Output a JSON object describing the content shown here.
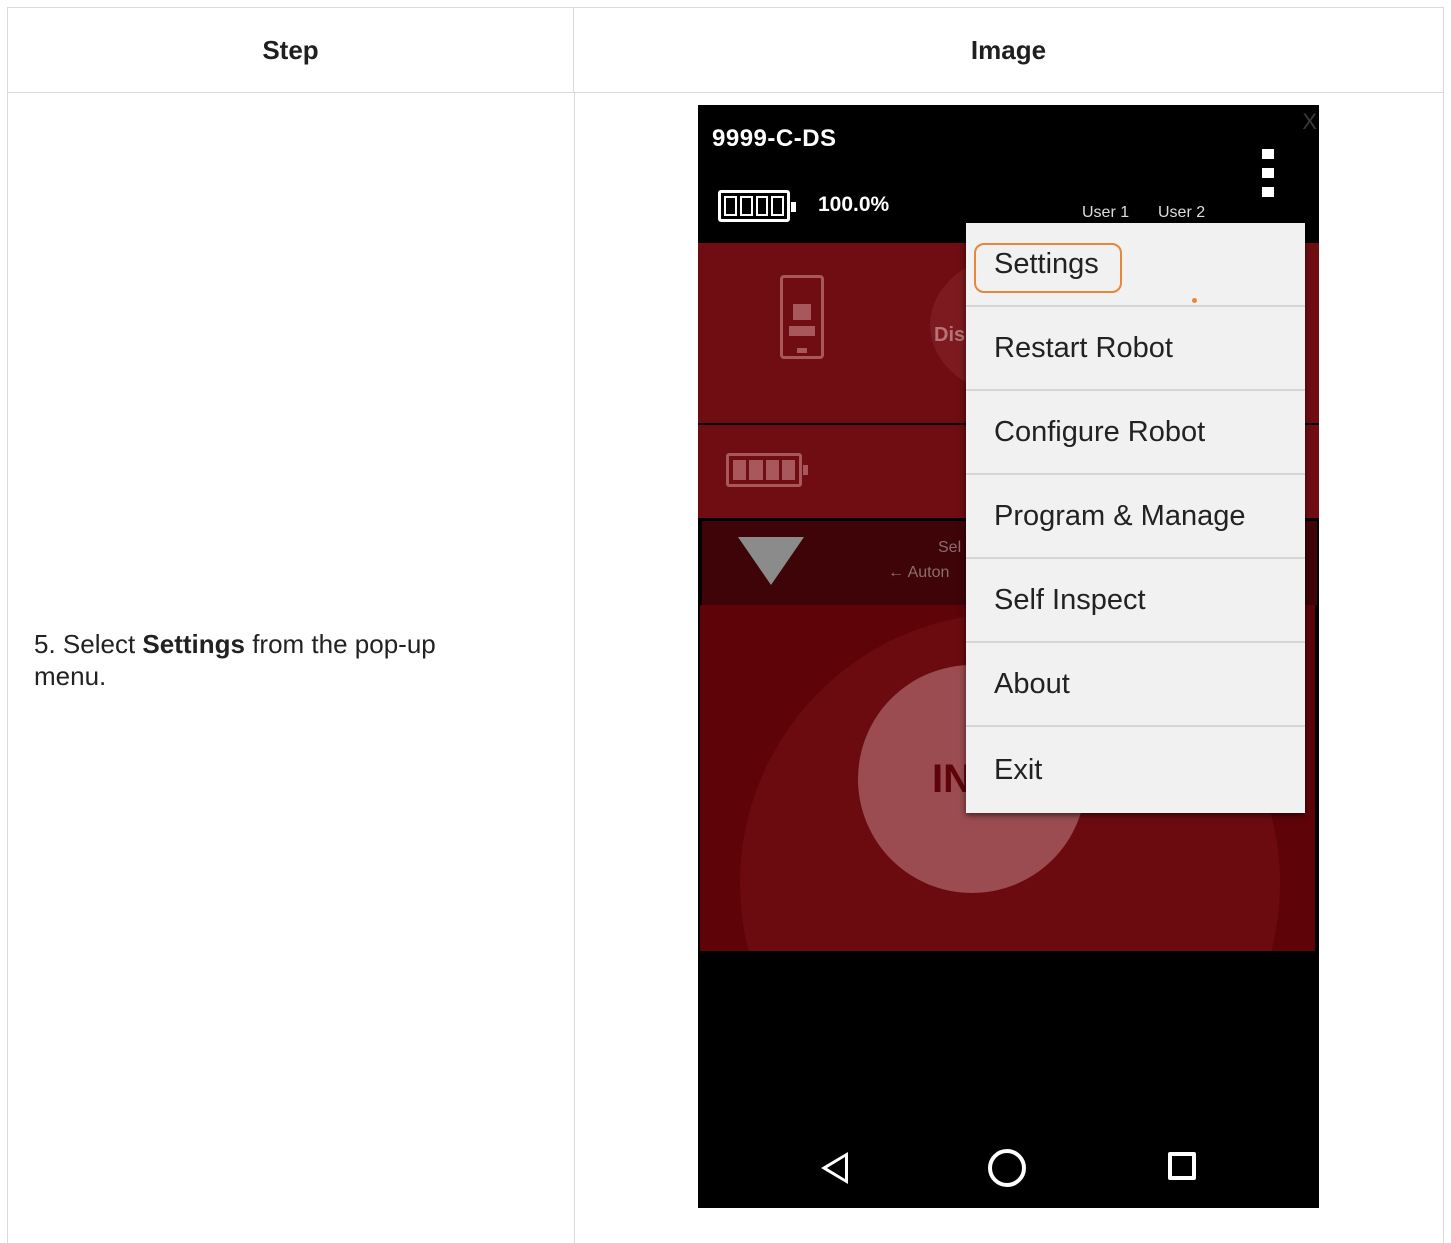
{
  "table": {
    "header_step": "Step",
    "header_image": "Image",
    "step_prefix": "5. Select ",
    "step_bold": "Settings",
    "step_suffix": " from the pop-up menu."
  },
  "app": {
    "title": "9999-C-DS",
    "close_glyph": "X",
    "battery_percent": "100.0%",
    "user1": "User 1",
    "user2": "User 2",
    "status_partial": "Dis",
    "select_partial": "Sel",
    "auto_partial": "← Auton",
    "init_partial": "IN"
  },
  "menu": {
    "items": [
      {
        "label": "Settings"
      },
      {
        "label": "Restart Robot"
      },
      {
        "label": "Configure Robot"
      },
      {
        "label": "Program & Manage"
      },
      {
        "label": "Self Inspect"
      },
      {
        "label": "About"
      },
      {
        "label": "Exit"
      }
    ]
  },
  "colors": {
    "highlight": "#e8873a",
    "panel_red": "#6f0d12",
    "menu_bg": "#f1f1f1"
  }
}
